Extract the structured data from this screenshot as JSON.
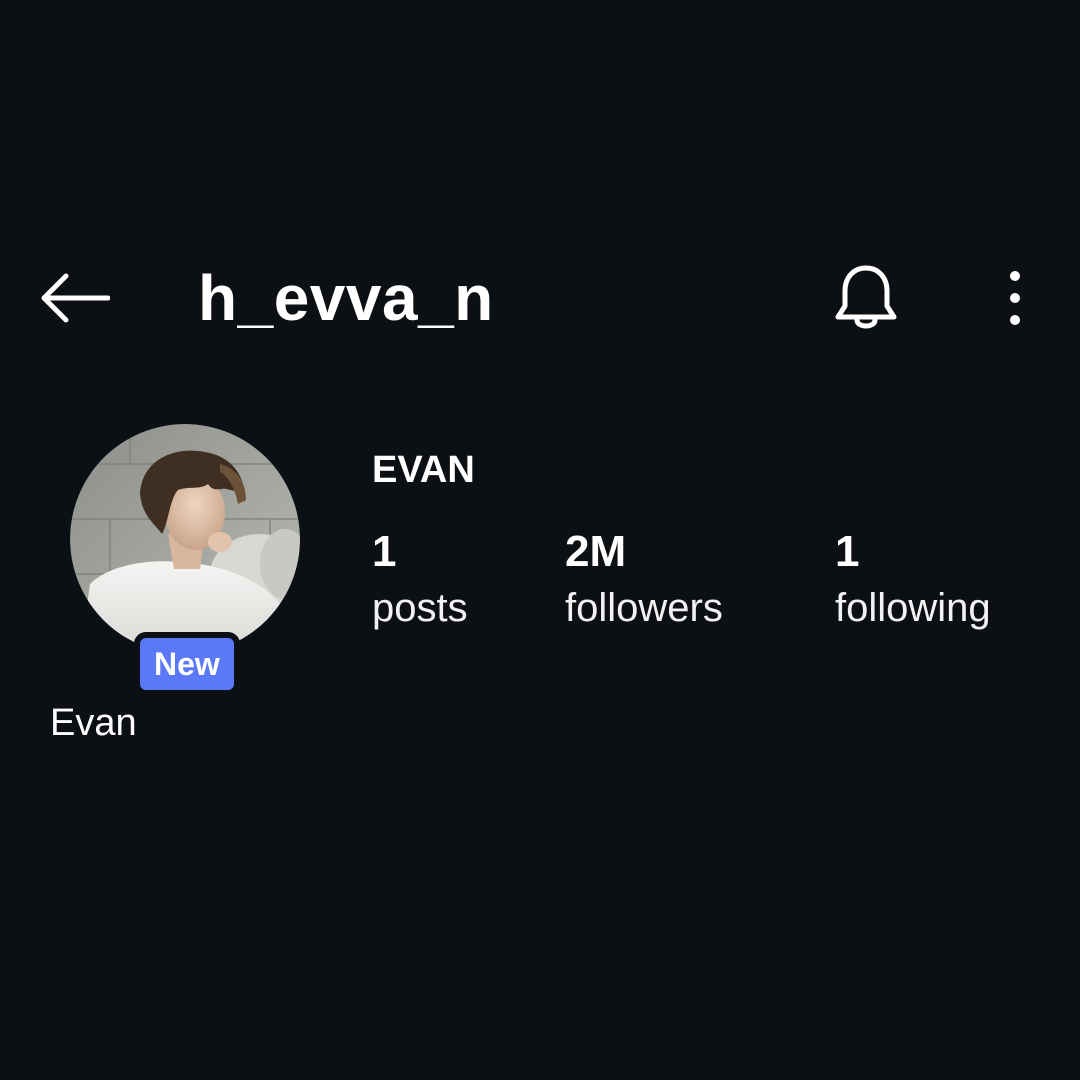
{
  "header": {
    "username": "h_evva_n",
    "icons": {
      "back": "arrow-left-icon",
      "notifications": "bell-icon",
      "more": "more-vertical-icon"
    }
  },
  "profile": {
    "display_name": "Evan",
    "full_name": "EVAN",
    "badge": "New",
    "avatar": "profile-photo",
    "stats": [
      {
        "value": "1",
        "label": "posts"
      },
      {
        "value": "2M",
        "label": "followers"
      },
      {
        "value": "1",
        "label": "following"
      }
    ]
  },
  "colors": {
    "background": "#0c0f14",
    "text": "#ffffff",
    "badge": "#5b78f6"
  }
}
